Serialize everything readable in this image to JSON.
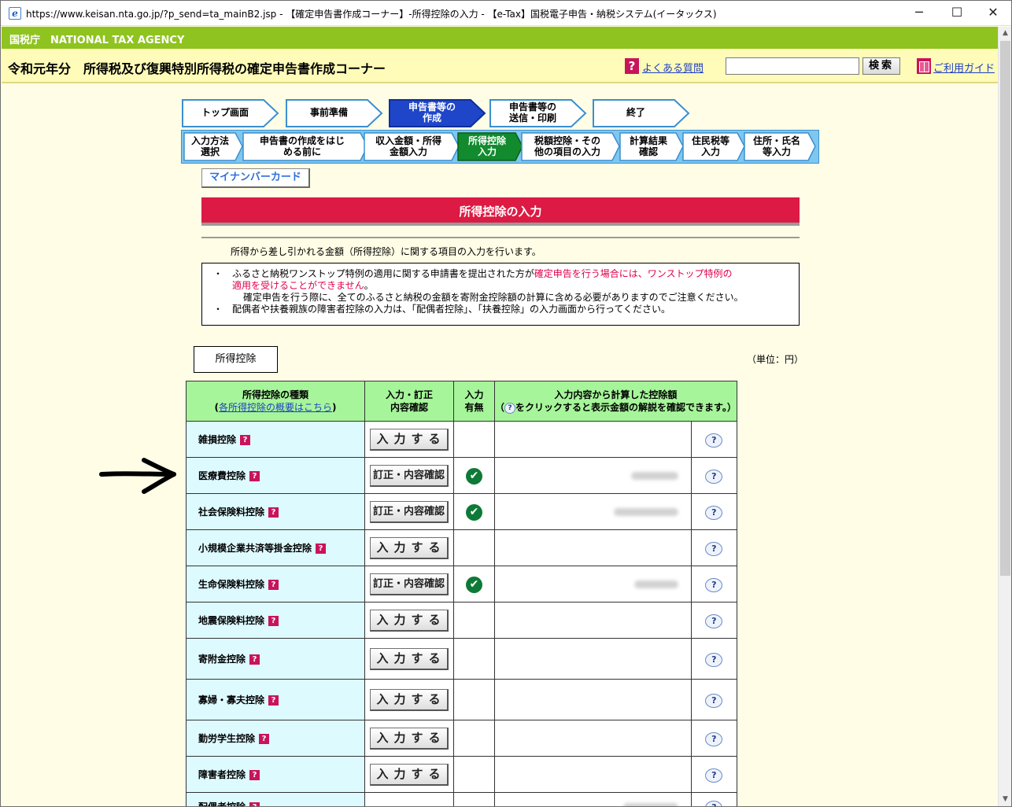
{
  "window": {
    "title": "https://www.keisan.nta.go.jp/?p_send=ta_mainB2.jsp - 【確定申告書作成コーナー】-所得控除の入力 - 【e-Tax】国税電子申告・納税システム(イータックス)",
    "minimize": "─",
    "maximize": "☐",
    "close": "✕"
  },
  "agency": {
    "label": "国税庁　NATIONAL TAX AGENCY",
    "color": "#8fc31f"
  },
  "header": {
    "title": "令和元年分　所得税及び復興特別所得税の確定申告書作成コーナー",
    "faq_icon": "?",
    "faq_link": "よくある質問",
    "search_value": "",
    "search_button": "検索",
    "guide_link": "ご利用ガイド"
  },
  "steps": [
    {
      "label": "トップ画面"
    },
    {
      "label": "事前準備"
    },
    {
      "label": "申告書等の\n作成"
    },
    {
      "label": "申告書等の\n送信・印刷"
    },
    {
      "label": "終了"
    }
  ],
  "substeps": [
    {
      "label": "入力方法\n選択"
    },
    {
      "label": "申告書の作成をはじ\nめる前に"
    },
    {
      "label": "収入金額・所得\n金額入力"
    },
    {
      "label": "所得控除\n入力"
    },
    {
      "label": "税額控除・その\n他の項目の入力"
    },
    {
      "label": "計算結果\n確認"
    },
    {
      "label": "住民税等\n入力"
    },
    {
      "label": "住所・氏名\n等入力"
    }
  ],
  "mynumber_tab": "マイナンバーカード",
  "page_title": "所得控除の入力",
  "intro": "所得から差し引かれる金額（所得控除）に関する項目の入力を行います。",
  "notice": {
    "bullet": "・",
    "line1_a": "ふるさと納税ワンストップ特例の適用に関する申請書を提出された方が",
    "line1_b": "確定申告を行う場合には、ワンストップ特例の",
    "line2": "適用を受けることができません",
    "line2_end": "。",
    "line3": "確定申告を行う際に、全てのふるさと納税の金額を寄附金控除額の計算に含める必要がありますのでご注意ください。",
    "line4": "配偶者や扶養親族の障害者控除の入力は、「配偶者控除」、「扶養控除」の入力画面から行ってください。"
  },
  "section_tab": "所得控除",
  "unit": "（単位：円）",
  "table": {
    "headers": {
      "type": "所得控除の種類",
      "type_link": "各所得控除の概要はこちら",
      "action_1": "入力・訂正",
      "action_2": "内容確認",
      "has_1": "入力",
      "has_2": "有無",
      "amount_1": "入力内容から計算した控除額",
      "amount_2a": "（",
      "amount_2b": "をクリックすると表示金額の解説を確認できます。）"
    },
    "rows": [
      {
        "name": "雑損控除",
        "button": "入力する",
        "entered": false,
        "amount": ""
      },
      {
        "name": "医療費控除",
        "button": "訂正・内容確認",
        "entered": true,
        "amount": "blurred"
      },
      {
        "name": "社会保険料控除",
        "button": "訂正・内容確認",
        "entered": true,
        "amount": "blurred"
      },
      {
        "name": "小規模企業共済等掛金控除",
        "button": "入力する",
        "entered": false,
        "amount": ""
      },
      {
        "name": "生命保険料控除",
        "button": "訂正・内容確認",
        "entered": true,
        "amount": "blurred"
      },
      {
        "name": "地震保険料控除",
        "button": "入力する",
        "entered": false,
        "amount": ""
      },
      {
        "name": "寄附金控除",
        "button": "入力する",
        "entered": false,
        "amount": ""
      },
      {
        "name": "寡婦・寡夫控除",
        "button": "入力する",
        "entered": false,
        "amount": ""
      },
      {
        "name": "勤労学生控除",
        "button": "入力する",
        "entered": false,
        "amount": ""
      },
      {
        "name": "障害者控除",
        "button": "入力する",
        "entered": false,
        "amount": ""
      },
      {
        "name": "配偶者控除",
        "button": "",
        "entered": false,
        "amount": "blurred"
      }
    ],
    "help_glyph": "?",
    "check_glyph": "✔",
    "qm_glyph": "?"
  },
  "colors": {
    "page_bg": "#fffde6",
    "header_bg": "#fffbb9",
    "title_red": "#dc1a43",
    "table_header": "#a6f59a",
    "row_label_bg": "#ddfaff",
    "step_active": "#1f46c9",
    "substep_active": "#128a2e",
    "link_blue": "#1f3fc5",
    "notice_red": "#e0004e"
  }
}
